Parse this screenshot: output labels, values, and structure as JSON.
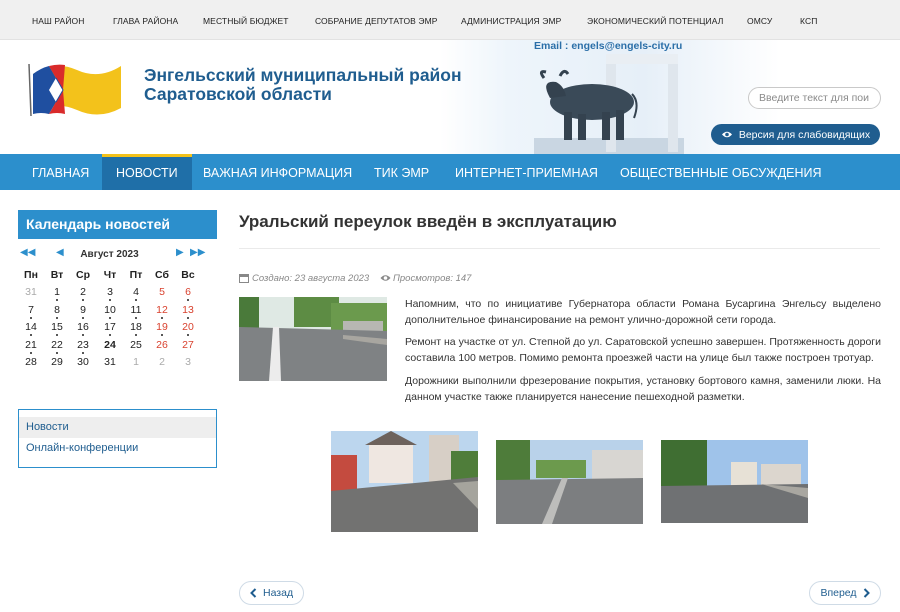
{
  "top_nav": [
    "НАШ РАЙОН",
    "ГЛАВА РАЙОНА",
    "МЕСТНЫЙ БЮДЖЕТ",
    "СОБРАНИЕ ДЕПУТАТОВ ЭМР",
    "АДМИНИСТРАЦИЯ ЭМР",
    "ЭКОНОМИЧЕСКИЙ ПОТЕНЦИАЛ",
    "ОМСУ",
    "КСП"
  ],
  "header": {
    "title_line1": "Энгельсский муниципальный район",
    "title_line2": "Саратовской области",
    "email": "Email : engels@engels-city.ru",
    "search_placeholder": "Введите текст для пои",
    "a11y_label": "Версия для слабовидящих"
  },
  "main_nav": [
    {
      "label": "ГЛАВНАЯ",
      "active": false
    },
    {
      "label": "НОВОСТИ",
      "active": true
    },
    {
      "label": "ВАЖНАЯ ИНФОРМАЦИЯ",
      "active": false
    },
    {
      "label": "ТИК ЭМР",
      "active": false
    },
    {
      "label": "ИНТЕРНЕТ-ПРИЕМНАЯ",
      "active": false
    },
    {
      "label": "ОБЩЕСТВЕННЫЕ ОБСУЖДЕНИЯ",
      "active": false
    }
  ],
  "calendar": {
    "title": "Календарь новостей",
    "month": "Август 2023",
    "weekdays": [
      "Пн",
      "Вт",
      "Ср",
      "Чт",
      "Пт",
      "Сб",
      "Вс"
    ],
    "weeks": [
      [
        {
          "d": "31",
          "muted": true
        },
        {
          "d": "1",
          "dot": true
        },
        {
          "d": "2",
          "dot": true
        },
        {
          "d": "3",
          "dot": true
        },
        {
          "d": "4",
          "dot": true
        },
        {
          "d": "5",
          "red": true
        },
        {
          "d": "6",
          "red": true,
          "dot": true
        }
      ],
      [
        {
          "d": "7",
          "dot": true
        },
        {
          "d": "8",
          "dot": true
        },
        {
          "d": "9",
          "dot": true
        },
        {
          "d": "10",
          "dot": true
        },
        {
          "d": "11",
          "dot": true
        },
        {
          "d": "12",
          "red": true,
          "dot": true
        },
        {
          "d": "13",
          "red": true,
          "dot": true
        }
      ],
      [
        {
          "d": "14",
          "dot": true
        },
        {
          "d": "15",
          "dot": true
        },
        {
          "d": "16",
          "dot": true
        },
        {
          "d": "17",
          "dot": true
        },
        {
          "d": "18",
          "dot": true
        },
        {
          "d": "19",
          "red": true,
          "dot": true
        },
        {
          "d": "20",
          "red": true,
          "dot": true
        }
      ],
      [
        {
          "d": "21",
          "dot": true
        },
        {
          "d": "22",
          "dot": true
        },
        {
          "d": "23",
          "dot": true
        },
        {
          "d": "24",
          "today": true
        },
        {
          "d": "25"
        },
        {
          "d": "26",
          "red": true
        },
        {
          "d": "27",
          "red": true
        }
      ],
      [
        {
          "d": "28"
        },
        {
          "d": "29"
        },
        {
          "d": "30"
        },
        {
          "d": "31"
        },
        {
          "d": "1",
          "muted": true
        },
        {
          "d": "2",
          "muted": true
        },
        {
          "d": "3",
          "muted": true
        }
      ]
    ]
  },
  "categories": [
    {
      "label": "Новости",
      "selected": true
    },
    {
      "label": "Онлайн-конференции",
      "selected": false
    }
  ],
  "article": {
    "title": "Уральский переулок введён в эксплуатацию",
    "created": "Создано: 23 августа 2023",
    "views": "Просмотров: 147",
    "paragraphs": [
      "Напомним, что по инициативе Губернатора области Романа Бусаргина Энгельсу выделено дополнительное финансирование на ремонт улично-дорожной сети города.",
      "Ремонт на участке от ул. Степной до ул. Саратовской успешно завершен. Протяженность дороги составила 100 метров. Помимо ремонта проезжей части на улице был также построен тротуар.",
      "Дорожники выполнили фрезерование покрытия, установку бортового камня, заменили люки. На данном участке также планируется нанесение пешеходной разметки."
    ]
  },
  "pagination": {
    "prev": "Назад",
    "next": "Вперед"
  },
  "colors": {
    "accent": "#2c8fcc",
    "nav_active": "#1f6fa8",
    "active_bar": "#f3c21b",
    "title_blue": "#1f5d8f",
    "weekend_red": "#d9422f"
  }
}
